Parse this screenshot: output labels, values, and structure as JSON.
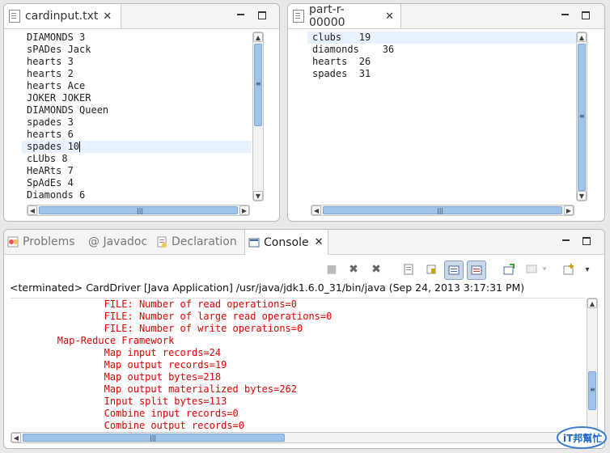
{
  "left_editor": {
    "tab_label": "cardinput.txt",
    "lines": [
      "DIAMONDS 3",
      "sPADes Jack",
      "hearts 3",
      "hearts 2",
      "hearts Ace",
      "JOKER JOKER",
      "DIAMONDS Queen",
      "spades 3",
      "hearts 6",
      "spades 10",
      "cLUbs 8",
      "HeARts 7",
      "SpAdEs 4",
      "Diamonds 6"
    ],
    "current_line": 9
  },
  "right_editor": {
    "tab_label": "part-r-00000",
    "lines": [
      "clubs   19",
      "diamonds    36",
      "hearts  26",
      "spades  31"
    ],
    "current_line": 0
  },
  "bottom": {
    "tabs": [
      {
        "label": "Problems",
        "icon": "problems-icon",
        "active": false
      },
      {
        "label": "@ Javadoc",
        "icon": "javadoc-icon",
        "active": false
      },
      {
        "label": "Declaration",
        "icon": "declaration-icon",
        "active": false
      },
      {
        "label": "Console",
        "icon": "console-icon",
        "active": true
      }
    ],
    "status": "<terminated> CardDriver [Java Application] /usr/java/jdk1.6.0_31/bin/java (Sep 24, 2013 3:17:31 PM)",
    "console_lines": [
      "                FILE: Number of read operations=0",
      "                FILE: Number of large read operations=0",
      "                FILE: Number of write operations=0",
      "        Map-Reduce Framework",
      "                Map input records=24",
      "                Map output records=19",
      "                Map output bytes=218",
      "                Map output materialized bytes=262",
      "                Input split bytes=113",
      "                Combine input records=0",
      "                Combine output records=0"
    ],
    "console_color": "#e00000"
  },
  "symbols": {
    "close": "✕",
    "minimize": "minimize",
    "maximize": "maximize",
    "grip": "|||",
    "up": "▲",
    "down": "▼",
    "left": "◀",
    "right": "▶"
  },
  "watermark": "iT邦幫忙"
}
